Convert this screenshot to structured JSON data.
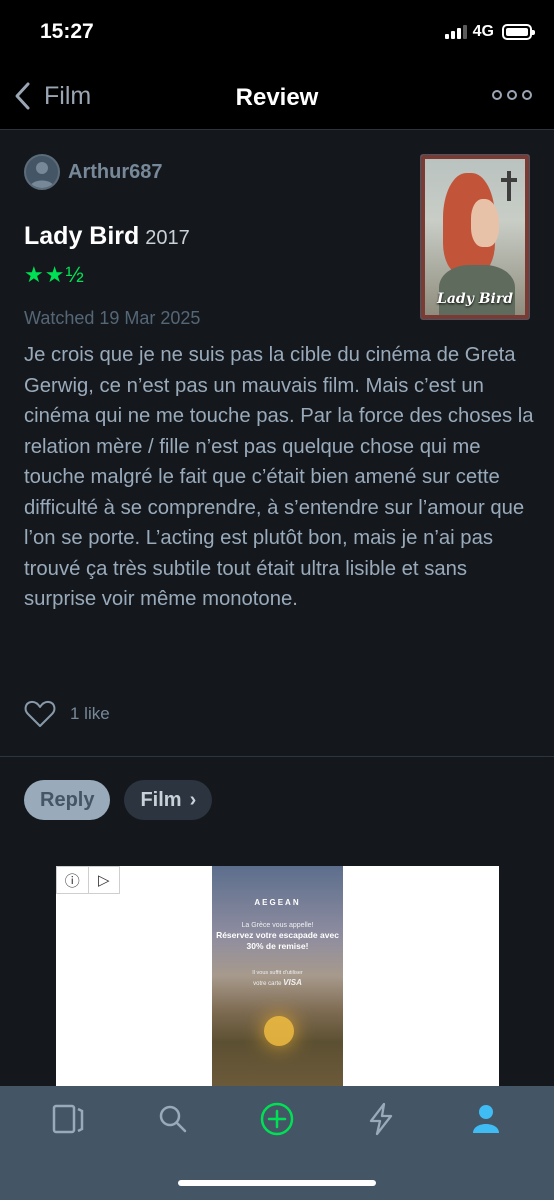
{
  "status_bar": {
    "time": "15:27",
    "network": "4G"
  },
  "nav": {
    "back_label": "Film",
    "title": "Review",
    "more_icon": "ellipsis-icon"
  },
  "review": {
    "author": "Arthur687",
    "film_title": "Lady Bird",
    "film_year": "2017",
    "rating_display": "★★½",
    "rating_stars": 2.5,
    "watched": "Watched 19 Mar 2025",
    "text": "Je crois que je ne suis pas la cible du cinéma de Greta Gerwig, ce n’est pas un mauvais film. Mais c’est un cinéma qui ne me touche pas. Par la force des choses la relation mère / fille n’est pas quelque chose qui me touche malgré le fait que c’était bien amené sur cette difficulté à se comprendre, à s’entendre sur l’amour que l’on se porte. L’acting est plutôt bon, mais je n’ai pas trouvé ça très subtile tout était ultra lisible et sans surprise voir même monotone.",
    "likes": "1 like",
    "poster_title": "Lady Bird"
  },
  "actions": {
    "reply_label": "Reply",
    "film_label": "Film"
  },
  "ad": {
    "brand": "AEGEAN",
    "line1": "La Grèce vous appelle!",
    "line2": "Réservez votre escapade avec 30% de remise!",
    "line3": "Il vous suffit d'utiliser",
    "line4_prefix": "votre carte",
    "line4_brand": "VISA"
  },
  "tab_bar": {
    "tabs": [
      "films-icon",
      "search-icon",
      "add-icon",
      "activity-icon",
      "profile-icon"
    ],
    "active": "profile-icon"
  },
  "colors": {
    "background": "#14181c",
    "rating_green": "#00e054",
    "tab_active": "#40bcf4",
    "tab_inactive": "#99aabb",
    "add_green": "#00e054"
  }
}
